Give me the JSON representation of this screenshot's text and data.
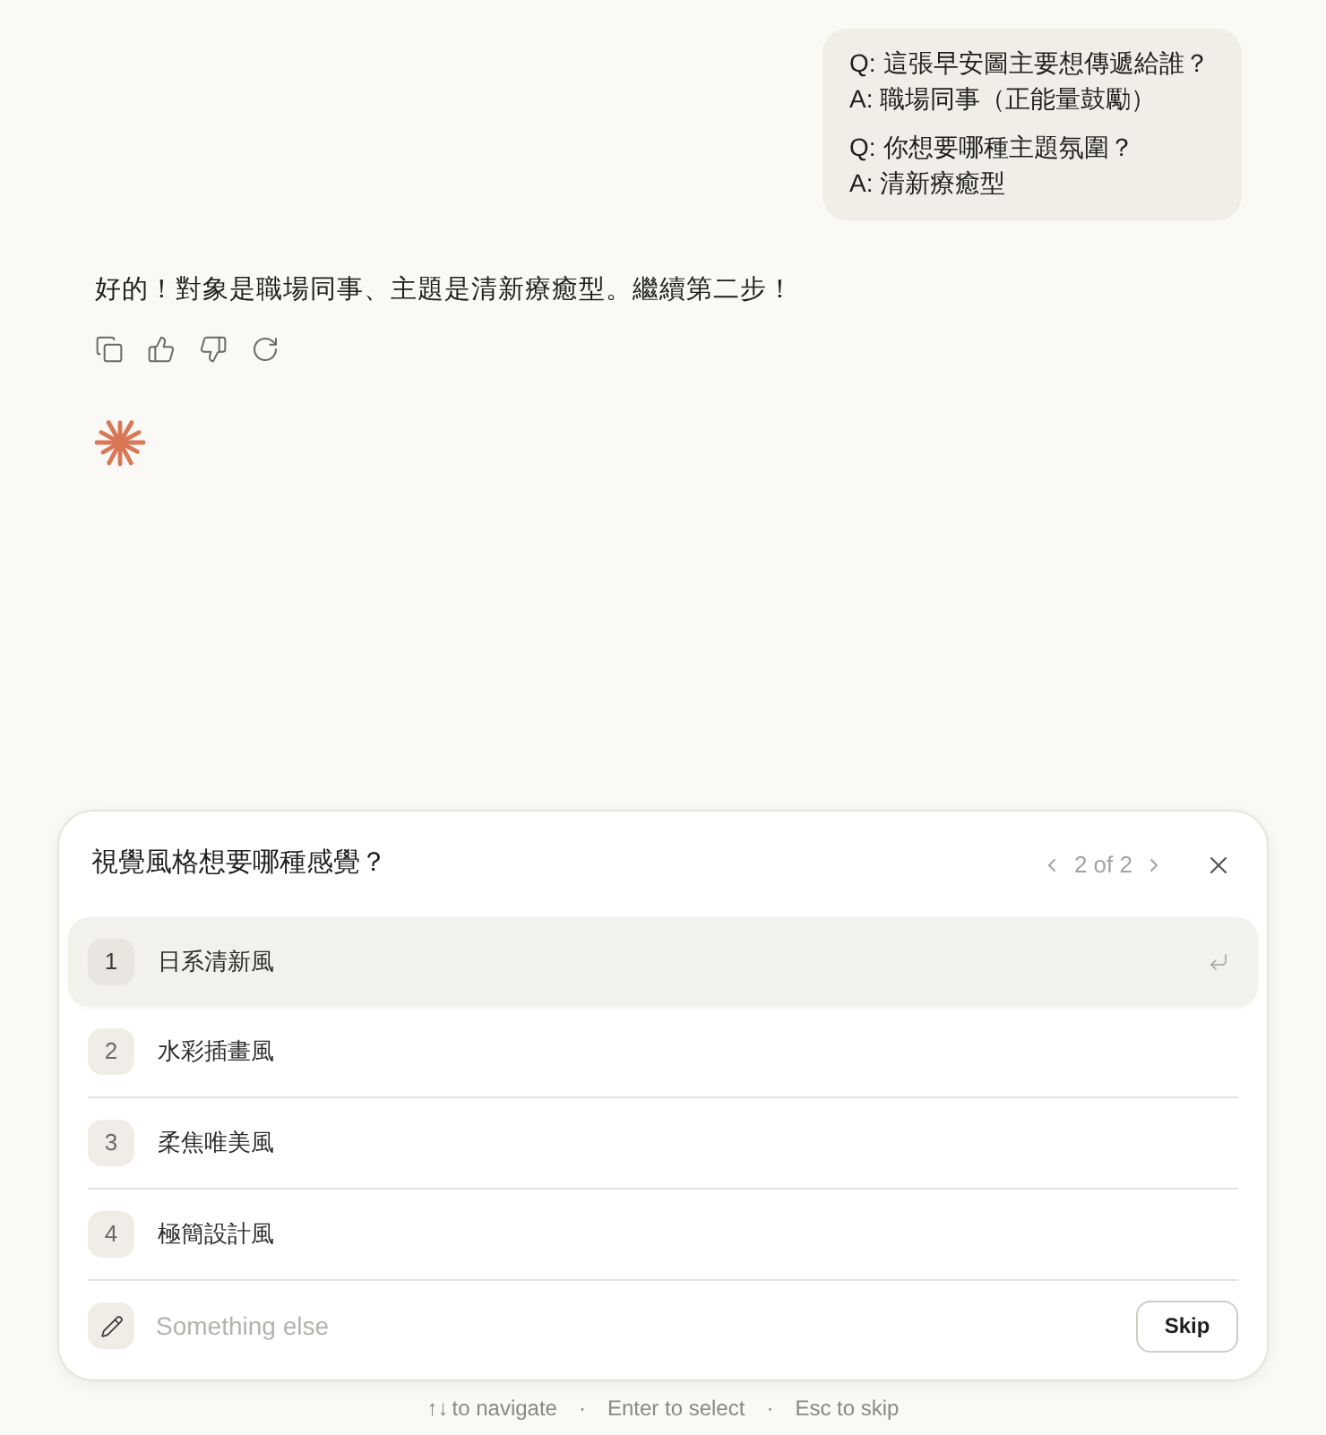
{
  "user_message": {
    "qa": [
      {
        "q_label": "Q:",
        "question": "這張早安圖主要想傳遞給誰？",
        "a_label": "A:",
        "answer": "職場同事（正能量鼓勵）"
      },
      {
        "q_label": "Q:",
        "question": "你想要哪種主題氛圍？",
        "a_label": "A:",
        "answer": "清新療癒型"
      }
    ]
  },
  "assistant_message": {
    "text": "好的！對象是職場同事、主題是清新療癒型。繼續第二步！"
  },
  "question_panel": {
    "title": "視覺風格想要哪種感覺？",
    "pager": "2 of 2",
    "options": [
      {
        "number": "1",
        "label": "日系清新風",
        "selected": true
      },
      {
        "number": "2",
        "label": "水彩插畫風",
        "selected": false
      },
      {
        "number": "3",
        "label": "柔焦唯美風",
        "selected": false
      },
      {
        "number": "4",
        "label": "極簡設計風",
        "selected": false
      }
    ],
    "custom_input": {
      "placeholder": "Something else"
    },
    "skip_button": "Skip"
  },
  "footer": {
    "items": [
      {
        "kind": "hint",
        "keys": "↑↓",
        "text": "to navigate"
      },
      {
        "kind": "separator",
        "text": "·"
      },
      {
        "kind": "hint",
        "text": "Enter to select"
      },
      {
        "kind": "separator",
        "text": "·"
      },
      {
        "kind": "hint",
        "text": "Esc to skip"
      }
    ]
  }
}
